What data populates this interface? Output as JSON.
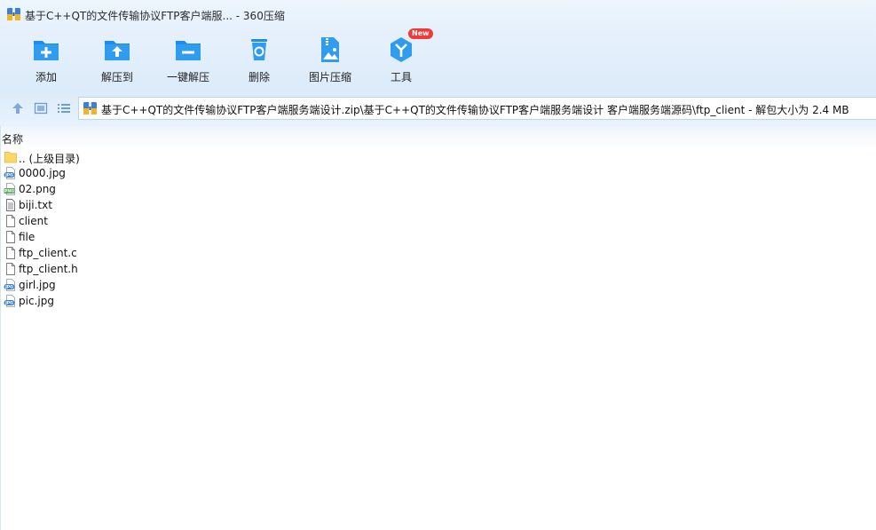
{
  "window": {
    "title": "基于C++QT的文件传输协议FTP客户端服... - 360压缩"
  },
  "toolbar": {
    "items": [
      {
        "label": "添加",
        "icon": "add-folder-icon"
      },
      {
        "label": "解压到",
        "icon": "extract-to-folder-icon"
      },
      {
        "label": "一键解压",
        "icon": "one-click-extract-icon"
      },
      {
        "label": "删除",
        "icon": "recycle-bin-icon"
      },
      {
        "label": "图片压缩",
        "icon": "image-compress-icon"
      },
      {
        "label": "工具",
        "icon": "tools-icon",
        "badge": "New"
      }
    ]
  },
  "nav": {
    "address": "基于C++QT的文件传输协议FTP客户端服务端设计.zip\\基于C++QT的文件传输协议FTP客户端服务端设计 客户端服务端源码\\ftp_client - 解包大小为 2.4 MB"
  },
  "list": {
    "column_name": "名称",
    "files": [
      {
        "name": ".. (上级目录)",
        "type": "folder"
      },
      {
        "name": "0000.jpg",
        "type": "jpg"
      },
      {
        "name": "02.png",
        "type": "png"
      },
      {
        "name": "biji.txt",
        "type": "txt"
      },
      {
        "name": "client",
        "type": "file"
      },
      {
        "name": "file",
        "type": "file"
      },
      {
        "name": "ftp_client.c",
        "type": "file"
      },
      {
        "name": "ftp_client.h",
        "type": "file"
      },
      {
        "name": "girl.jpg",
        "type": "jpg"
      },
      {
        "name": "pic.jpg",
        "type": "jpg"
      }
    ]
  },
  "colors": {
    "accent": "#1e8ee8",
    "badge": "#f03a3a"
  }
}
